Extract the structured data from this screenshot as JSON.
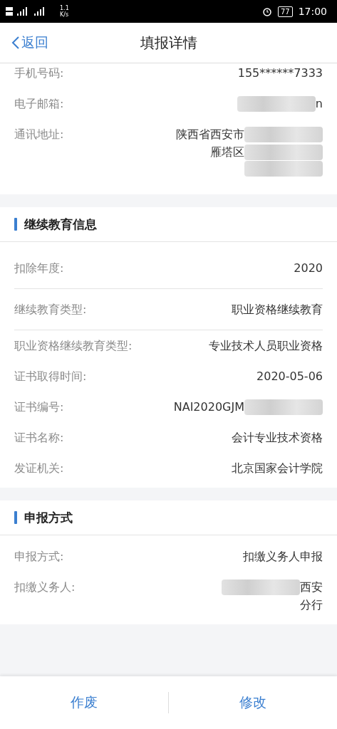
{
  "status_bar": {
    "network_speed": "1.1",
    "network_unit": "K/s",
    "battery": "77",
    "time": "17:00"
  },
  "nav": {
    "back": "返回",
    "title": "填报详情"
  },
  "sections": [
    {
      "rows": [
        {
          "label": "手机号码:",
          "divided": false,
          "value": [
            {
              "kind": "text",
              "text": "155******7333"
            }
          ]
        },
        {
          "label": "电子邮箱:",
          "divided": false,
          "value": [
            {
              "kind": "redaction"
            },
            {
              "kind": "text",
              "text": "n"
            }
          ]
        },
        {
          "label": "通讯地址:",
          "divided": false,
          "value": [
            {
              "kind": "text",
              "text": "陕西省西安市"
            },
            {
              "kind": "redaction"
            },
            {
              "kind": "break"
            },
            {
              "kind": "text",
              "text": "雁塔区"
            },
            {
              "kind": "redaction"
            },
            {
              "kind": "break"
            },
            {
              "kind": "redaction"
            }
          ]
        }
      ]
    },
    {
      "title": "继续教育信息",
      "rows": [
        {
          "label": "扣除年度:",
          "divided": true,
          "value": [
            {
              "kind": "text",
              "text": "2020"
            }
          ]
        },
        {
          "label": "继续教育类型:",
          "divided": true,
          "value": [
            {
              "kind": "text",
              "text": "职业资格继续教育"
            }
          ]
        },
        {
          "label": "职业资格继续教育类型:",
          "divided": false,
          "value": [
            {
              "kind": "text",
              "text": "专业技术人员职业资格"
            }
          ]
        },
        {
          "label": "证书取得时间:",
          "divided": false,
          "value": [
            {
              "kind": "text",
              "text": "2020-05-06"
            }
          ]
        },
        {
          "label": "证书编号:",
          "divided": false,
          "value": [
            {
              "kind": "text",
              "text": "NAI2020GJM"
            },
            {
              "kind": "redaction"
            }
          ]
        },
        {
          "label": "证书名称:",
          "divided": false,
          "value": [
            {
              "kind": "text",
              "text": "会计专业技术资格"
            }
          ]
        },
        {
          "label": "发证机关:",
          "divided": false,
          "value": [
            {
              "kind": "text",
              "text": "北京国家会计学院"
            }
          ]
        }
      ]
    },
    {
      "title": "申报方式",
      "rows": [
        {
          "label": "申报方式:",
          "divided": false,
          "value": [
            {
              "kind": "text",
              "text": "扣缴义务人申报"
            }
          ]
        },
        {
          "label": "扣缴义务人:",
          "divided": false,
          "value": [
            {
              "kind": "redaction"
            },
            {
              "kind": "text",
              "text": "西安"
            },
            {
              "kind": "break"
            },
            {
              "kind": "text",
              "text": "分行"
            }
          ]
        }
      ]
    }
  ],
  "actions": [
    "作废",
    "修改"
  ]
}
